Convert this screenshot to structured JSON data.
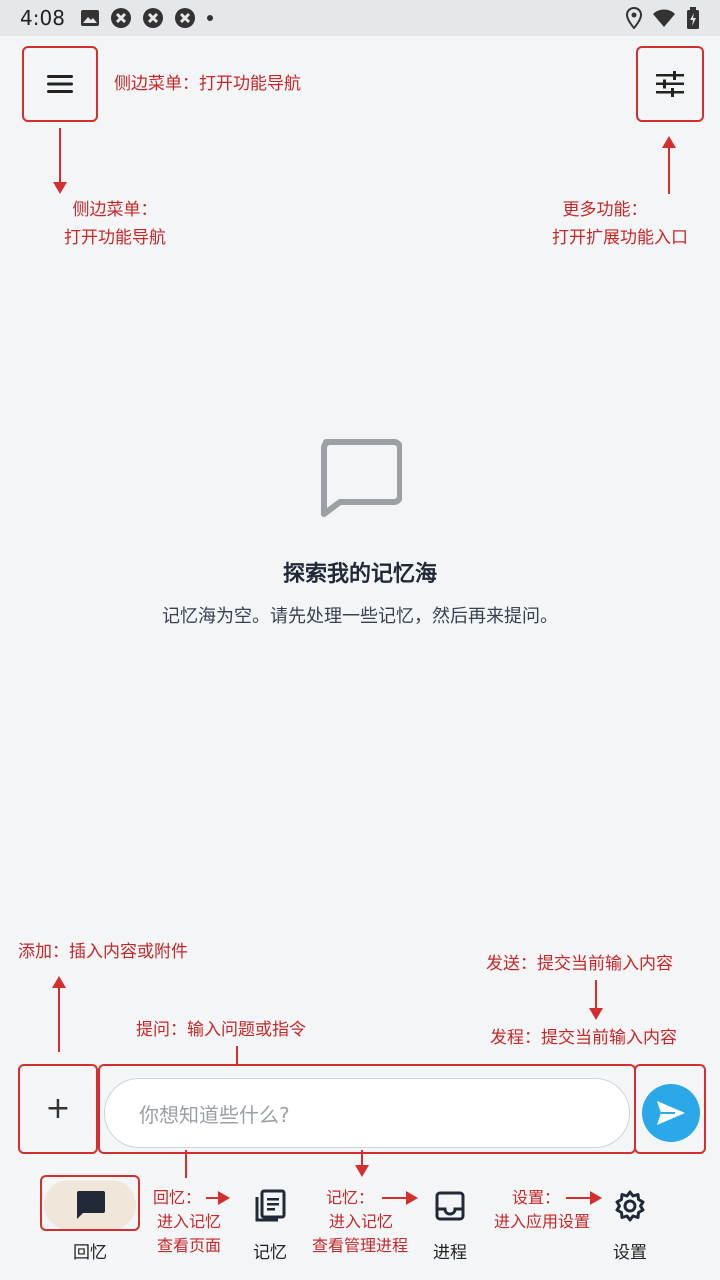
{
  "status_bar": {
    "time": "4:08"
  },
  "empty_state": {
    "title": "探索我的记忆海",
    "subtitle": "记忆海为空。请先处理一些记忆，然后再来提问。"
  },
  "input": {
    "placeholder": "你想知道些什么?"
  },
  "bottom_nav": {
    "items": [
      {
        "label": "回忆",
        "icon": "chat-bubble-icon",
        "active": true
      },
      {
        "label": "记忆",
        "icon": "notes-icon"
      },
      {
        "label": "进程",
        "icon": "inbox-tray-icon"
      },
      {
        "label": "设置",
        "icon": "gear-icon"
      }
    ]
  },
  "annotations": {
    "menu_box": "侧边菜单：打开功能导航",
    "menu_below_1": "侧边菜单：",
    "menu_below_2": "打开功能导航",
    "more_1": "更多功能：",
    "more_2": "打开扩展功能入口",
    "add": "添加：插入内容或附件",
    "ask": "提问：输入问题或指令",
    "send_top": "发送：提交当前输入内容",
    "send_bottom": "发程：提交当前输入内容",
    "recall_1": "回忆：",
    "recall_2": "进入记忆",
    "recall_3": "查看页面",
    "memory_1": "记忆：",
    "memory_2": "进入记忆",
    "memory_3": "查看管理进程",
    "settings_1": "设置：",
    "settings_2": "进入应用设置"
  },
  "colors": {
    "annotation_red": "#d32f2f",
    "send_blue": "#2ba8e8",
    "active_pill": "#f1e6da"
  }
}
